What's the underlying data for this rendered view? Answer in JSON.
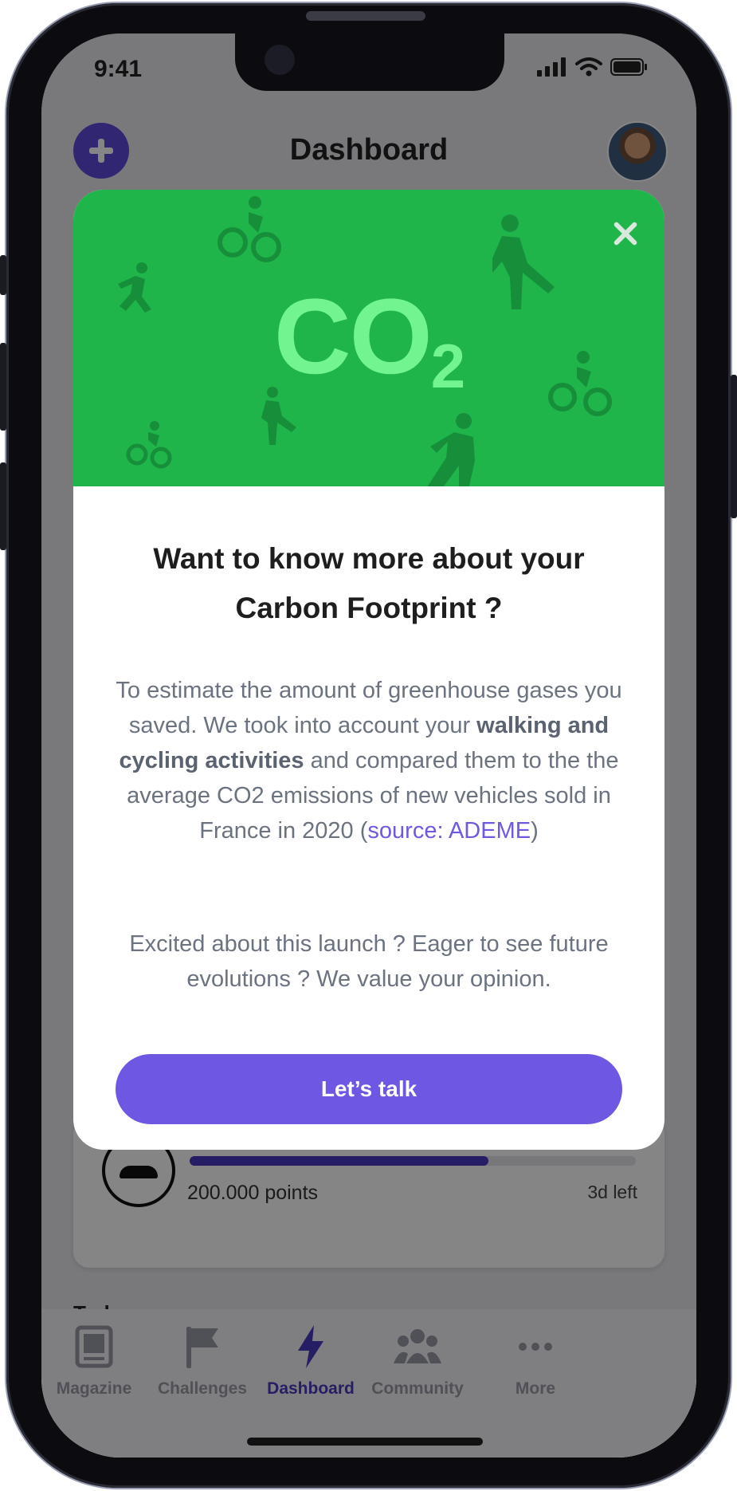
{
  "status_bar": {
    "time": "9:41"
  },
  "header": {
    "title": "Dashboard"
  },
  "background_card": {
    "points": "200.000 points",
    "time_left": "3d left",
    "progress": 0.67
  },
  "section": {
    "today": "Today"
  },
  "tabs": [
    {
      "label": "Magazine",
      "icon": "magazine-icon"
    },
    {
      "label": "Challenges",
      "icon": "flag-icon"
    },
    {
      "label": "Dashboard",
      "icon": "lightning-icon",
      "active": true
    },
    {
      "label": "Community",
      "icon": "people-icon"
    },
    {
      "label": "More",
      "icon": "more-icon"
    }
  ],
  "modal": {
    "hero_text": "CO",
    "hero_sub": "2",
    "title": "Want to know more about your Carbon Footprint ?",
    "body_part1": "To estimate the amount of greenhouse gases you saved. We took into account your ",
    "body_bold": "walking and cycling activities",
    "body_part2": " and compared them to the the average CO2 emissions of new vehicles sold in France in 2020 (",
    "body_link": "source: ADEME",
    "body_part3": ")",
    "body2": "Excited about this launch ? Eager to see future evolutions ? We value your opinion.",
    "cta_label": "Let’s talk"
  },
  "colors": {
    "accent": "#6d57e3",
    "hero_green": "#1fb54a",
    "co2_green": "#72f490"
  }
}
